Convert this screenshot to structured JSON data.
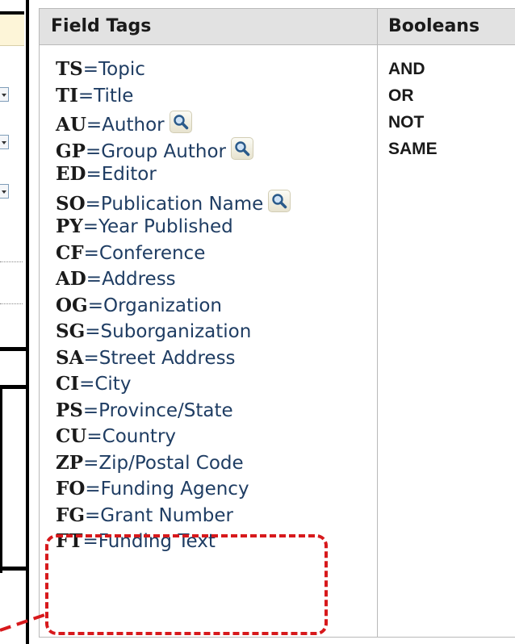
{
  "table": {
    "header_field_tags": "Field Tags",
    "header_booleans": "Booleans"
  },
  "field_tags": [
    {
      "code": "TS",
      "label": "=Topic",
      "lookup": false
    },
    {
      "code": "TI",
      "label": "=Title",
      "lookup": false
    },
    {
      "code": "AU",
      "label": "=Author",
      "lookup": true
    },
    {
      "code": "GP",
      "label": "=Group Author",
      "lookup": true
    },
    {
      "code": "ED",
      "label": "=Editor",
      "lookup": false
    },
    {
      "code": "SO",
      "label": "=Publication Name",
      "lookup": true
    },
    {
      "code": "PY",
      "label": "=Year Published",
      "lookup": false
    },
    {
      "code": "CF",
      "label": "=Conference",
      "lookup": false
    },
    {
      "code": "AD",
      "label": "=Address",
      "lookup": false
    },
    {
      "code": "OG",
      "label": "=Organization",
      "lookup": false
    },
    {
      "code": "SG",
      "label": "=Suborganization",
      "lookup": false
    },
    {
      "code": "SA",
      "label": "=Street Address",
      "lookup": false
    },
    {
      "code": "CI",
      "label": "=City",
      "lookup": false
    },
    {
      "code": "PS",
      "label": "=Province/State",
      "lookup": false
    },
    {
      "code": "CU",
      "label": "=Country",
      "lookup": false
    },
    {
      "code": "ZP",
      "label": "=Zip/Postal Code",
      "lookup": false
    },
    {
      "code": "FO",
      "label": "=Funding Agency",
      "lookup": false
    },
    {
      "code": "FG",
      "label": "=Grant Number",
      "lookup": false
    },
    {
      "code": "FT",
      "label": "=Funding Text",
      "lookup": false
    }
  ],
  "booleans": [
    "AND",
    "OR",
    "NOT",
    "SAME"
  ],
  "icons": {
    "lookup": "magnifier-icon"
  },
  "colors": {
    "header_bg": "#e2e2e2",
    "tag_text": "#1f3d63",
    "highlight": "#d7191c"
  }
}
